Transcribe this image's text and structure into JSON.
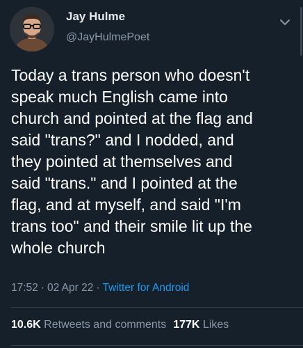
{
  "author": {
    "display_name": "Jay Hulme",
    "handle": "@JayHulmePoet"
  },
  "tweet": {
    "text": "Today a trans person who doesn't\nspeak much English came into\nchurch and pointed at the flag and\nsaid \"trans?\" and I nodded, and\nthey pointed at themselves and\nsaid \"trans.\" and I pointed at the\nflag, and at myself, and said \"I'm\ntrans too\" and their smile lit up the\nwhole church",
    "time": "17:52",
    "separator": "·",
    "date": "02 Apr 22",
    "source": "Twitter for Android"
  },
  "stats": {
    "retweets_count": "10.6K",
    "retweets_label": "Retweets and comments",
    "likes_count": "177K",
    "likes_label": "Likes"
  },
  "icons": {
    "menu": "chevron-down-icon",
    "avatar": "avatar"
  },
  "colors": {
    "background": "#15202b",
    "link": "#1d9bf0",
    "secondary_text": "#8b98a5"
  }
}
